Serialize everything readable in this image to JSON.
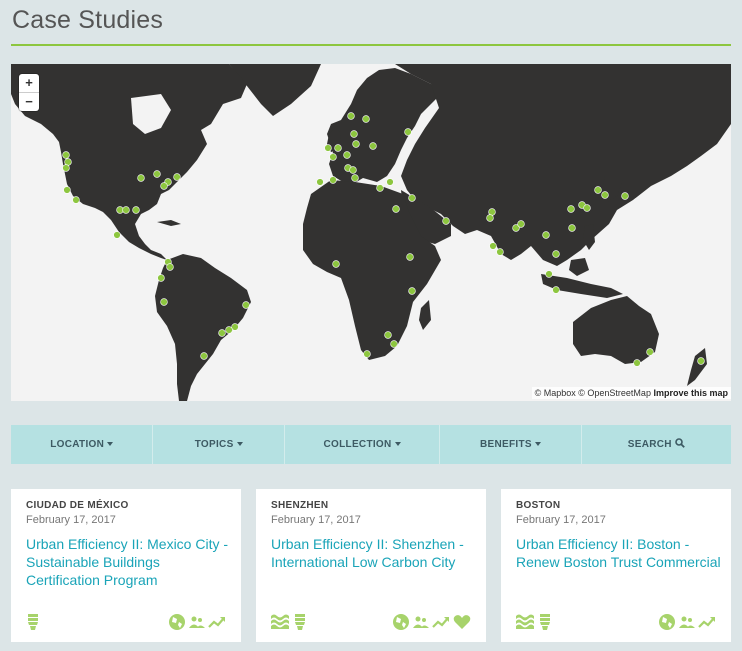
{
  "page": {
    "title": "Case Studies"
  },
  "map": {
    "zoom_in_label": "+",
    "zoom_out_label": "−",
    "attribution": "© Mapbox © OpenStreetMap",
    "improve_label": "Improve this map",
    "land_color": "#333231",
    "water_color": "#f3f3f3",
    "marker_color": "#8dc63f"
  },
  "filters": {
    "location": "LOCATION",
    "topics": "TOPICS",
    "collection": "COLLECTION",
    "benefits": "BENEFITS",
    "search": "SEARCH"
  },
  "cards": [
    {
      "location": "CIUDAD DE MÉXICO",
      "date": "February 17, 2017",
      "title": "Urban Efficiency II: Mexico City - Sustainable Buildings Certification Program"
    },
    {
      "location": "SHENZHEN",
      "date": "February 17, 2017",
      "title": "Urban Efficiency II: Shenzhen - International Low Carbon City"
    },
    {
      "location": "BOSTON",
      "date": "February 17, 2017",
      "title": "Urban Efficiency II: Boston - Renew Boston Trust Commercial"
    }
  ],
  "colors": {
    "accent": "#8dc63f",
    "link": "#1aa4b8",
    "filter_bg": "#b5e1e2"
  }
}
